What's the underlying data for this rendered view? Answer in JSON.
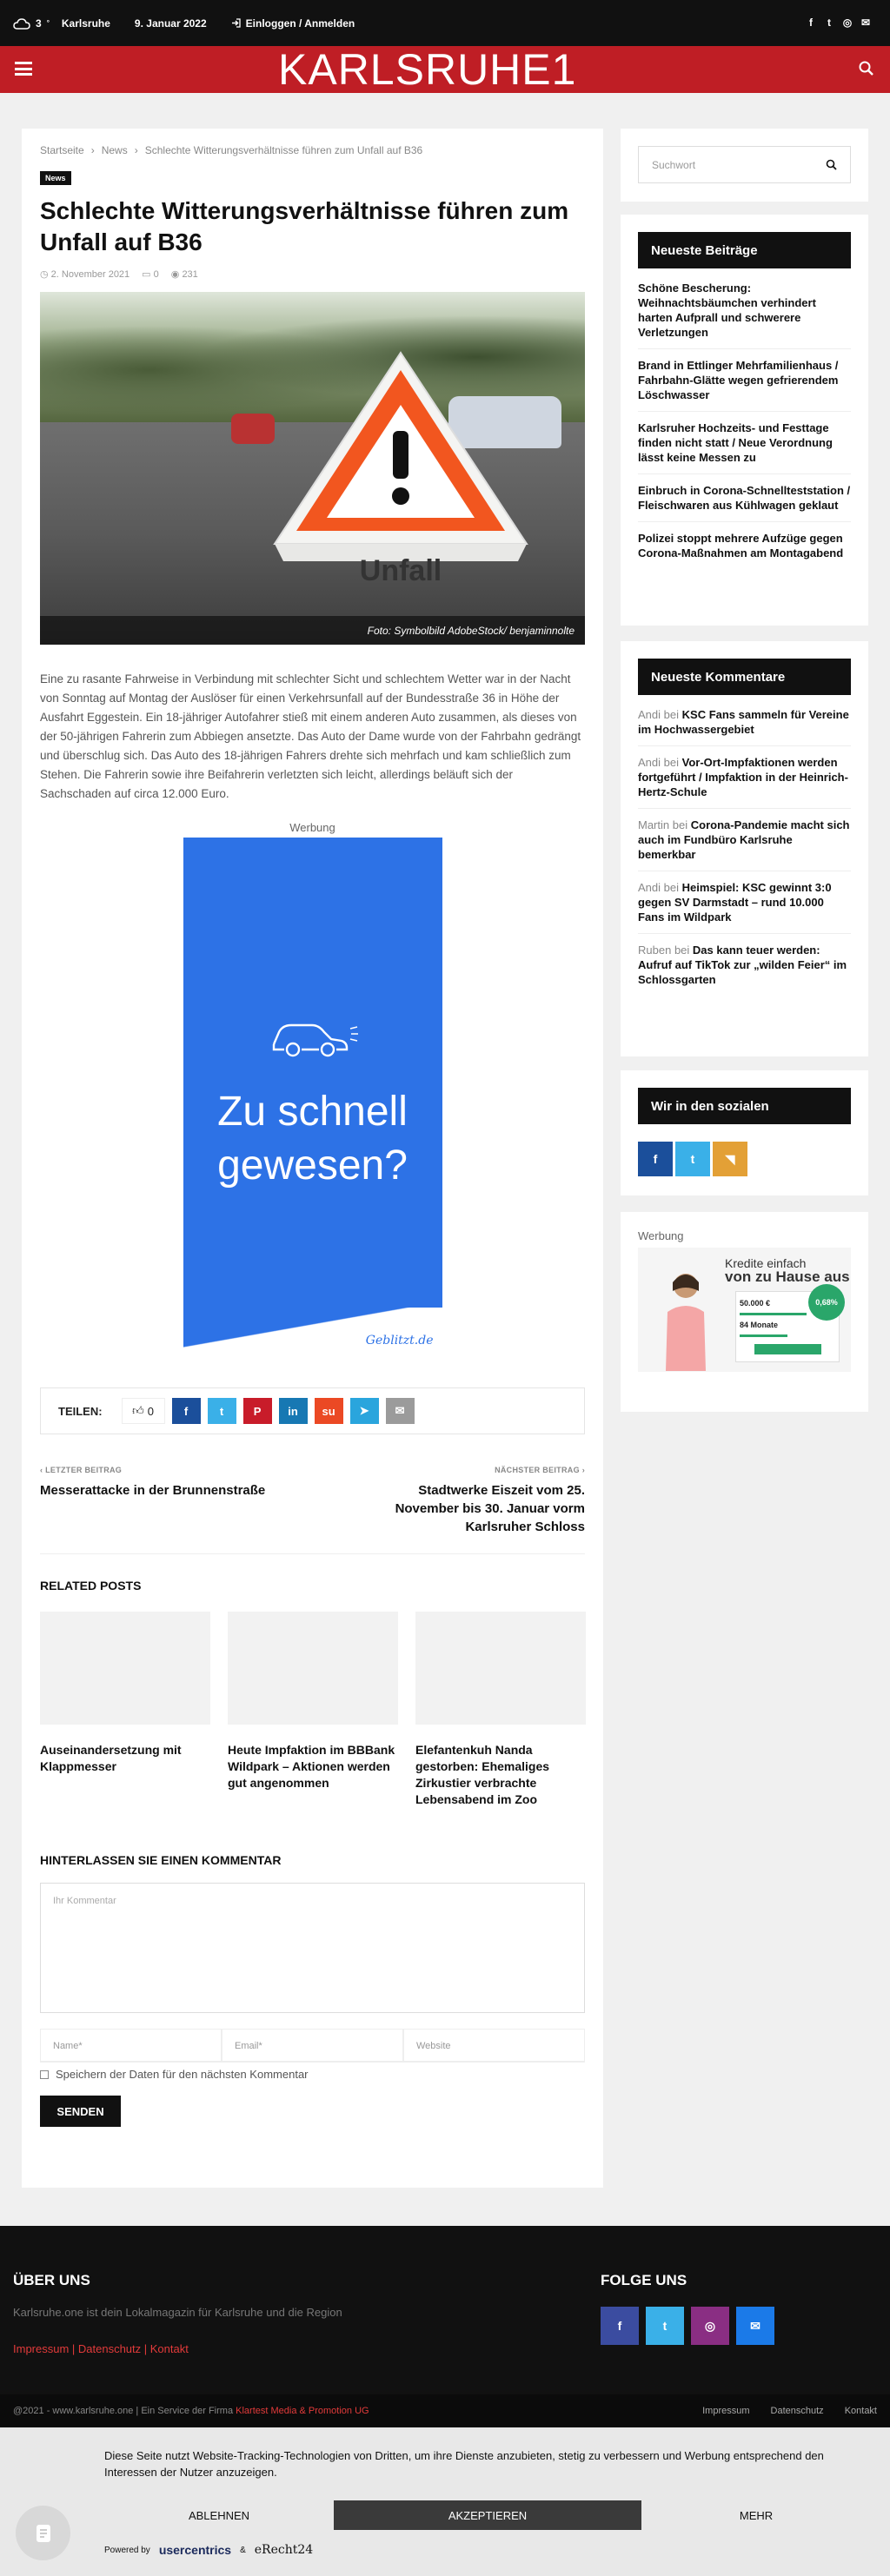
{
  "topbar": {
    "temp": "3",
    "deg": "°",
    "city": "Karlsruhe",
    "date": "9. Januar 2022",
    "login": "Einloggen / Anmelden"
  },
  "brand": {
    "logo": "KARLSRUHE1"
  },
  "breadcrumb": [
    "Startseite",
    "News",
    "Schlechte Witterungsverhältnisse führen zum Unfall auf B36"
  ],
  "article": {
    "category": "News",
    "title": "Schlechte Witterungsverhältnisse führen zum Unfall auf B36",
    "date": "2. November 2021",
    "comments": "0",
    "views": "231",
    "sign_text": "Unfall",
    "caption": "Foto: Symbolbild AdobeStock/ benjaminnolte",
    "body": "Eine zu rasante Fahrweise in Verbindung mit schlechter Sicht und schlechtem Wetter war in der Nacht von Sonntag auf Montag der Auslöser für einen Verkehrsunfall auf der Bundesstraße 36 in Höhe der Ausfahrt Eggestein. Ein 18-jähriger Autofahrer stieß mit einem anderen Auto zusammen, als dieses von der 50-jährigen Fahrerin zum Abbiegen ansetzte. Das Auto der Dame wurde von der Fahrbahn gedrängt und überschlug sich. Das Auto des 18-jährigen Fahrers drehte sich mehrfach und kam schließlich zum Stehen. Die Fahrerin sowie ihre Beifahrerin verletzten sich leicht, allerdings beläuft sich der Sachschaden auf circa 12.000 Euro."
  },
  "ad": {
    "label": "Werbung",
    "line1": "Zu schnell",
    "line2": "gewesen?",
    "brand": "Geblitzt.de"
  },
  "share": {
    "label": "TEILEN:",
    "count": "0",
    "buttons": [
      {
        "name": "facebook",
        "glyph": "f",
        "color": "#1b4f9b"
      },
      {
        "name": "twitter",
        "glyph": "t",
        "color": "#3ab0e8"
      },
      {
        "name": "pinterest",
        "glyph": "P",
        "color": "#c81c2a"
      },
      {
        "name": "linkedin",
        "glyph": "in",
        "color": "#1778b3"
      },
      {
        "name": "stumbleupon",
        "glyph": "su",
        "color": "#eb4924"
      },
      {
        "name": "telegram",
        "glyph": "➤",
        "color": "#2aa5dd"
      },
      {
        "name": "email",
        "glyph": "✉",
        "color": "#9b9b9b"
      }
    ]
  },
  "postnav": {
    "prev_label": "LETZTER BEITRAG",
    "prev_title": "Messerattacke in der Brunnenstraße",
    "next_label": "NÄCHSTER BEITRAG",
    "next_title": "Stadtwerke Eiszeit vom 25. November bis 30. Januar vorm Karlsruher Schloss"
  },
  "related": {
    "title": "RELATED POSTS",
    "items": [
      "Auseinandersetzung mit Klappmesser",
      "Heute Impfaktion im BBBank Wildpark – Aktionen werden gut angenommen",
      "Elefantenkuh Nanda gestorben: Ehemaliges Zirkustier verbrachte Lebensabend im Zoo"
    ]
  },
  "comment": {
    "title": "HINTERLASSEN SIE EINEN KOMMENTAR",
    "placeholder": "Ihr Kommentar",
    "name": "Name*",
    "email": "Email*",
    "website": "Website",
    "save": "Speichern der Daten für den nächsten Kommentar",
    "send": "SENDEN"
  },
  "sidebar": {
    "search_placeholder": "Suchwort",
    "recent_title": "Neueste Beiträge",
    "recent": [
      "Schöne Bescherung: Weihnachtsbäumchen verhindert harten Aufprall und schwerere Verletzungen",
      "Brand in Ettlinger Mehrfamilienhaus / Fahrbahn-Glätte wegen gefrierendem Löschwasser",
      "Karlsruher Hochzeits- und Festtage finden nicht statt / Neue Verordnung lässt keine Messen zu",
      "Einbruch in Corona-Schnellteststation / Fleischwaren aus Kühlwagen geklaut",
      "Polizei stoppt mehrere Aufzüge gegen Corona-Maßnahmen am Montagabend"
    ],
    "comments_title": "Neueste Kommentare",
    "comments": [
      {
        "author": "Andi",
        "on": "bei",
        "title": "KSC Fans sammeln für Vereine im Hochwassergebiet"
      },
      {
        "author": "Andi",
        "on": "bei",
        "title": "Vor-Ort-Impfaktionen werden fortgeführt / Impfaktion in der Heinrich-Hertz-Schule"
      },
      {
        "author": "Martin",
        "on": "bei",
        "title": "Corona-Pandemie macht sich auch im Fundbüro Karlsruhe bemerkbar"
      },
      {
        "author": "Andi",
        "on": "bei",
        "title": "Heimspiel: KSC gewinnt 3:0 gegen SV Darmstadt – rund 10.000 Fans im Wildpark"
      },
      {
        "author": "Ruben",
        "on": "bei",
        "title": "Das kann teuer werden: Aufruf auf TikTok zur „wilden Feier“ im Schlossgarten"
      }
    ],
    "social_title": "Wir in den sozialen",
    "ad_label": "Werbung",
    "credit_line1": "Kredite einfach",
    "credit_line2": "von zu Hause aus",
    "credit_amount": "50.000 €",
    "credit_term": "84 Monate",
    "credit_rate": "0,68%"
  },
  "footer": {
    "about_title": "ÜBER UNS",
    "about_text": "Karlsruhe.one ist dein Lokalmagazin für Karlsruhe und die Region",
    "links": "Impressum | Datenschutz | Kontakt",
    "follow_title": "FOLGE UNS",
    "copyright_prefix": "@2021 - www.karlsruhe.one | Ein Service der Firma",
    "copyright_company": "Klartest Media & Promotion UG",
    "bottom_links": [
      "Impressum",
      "Datenschutz",
      "Kontakt"
    ]
  },
  "cookie": {
    "text": "Diese Seite nutzt Website-Tracking-Technologien von Dritten, um ihre Dienste anzubieten, stetig zu verbessern und Werbung entsprechend den Interessen der Nutzer anzuzeigen.",
    "reject": "ABLEHNEN",
    "accept": "AKZEPTIEREN",
    "more": "MEHR",
    "powered": "Powered by",
    "uc": "usercentrics",
    "amp": "&",
    "erecht": "eRecht24"
  }
}
